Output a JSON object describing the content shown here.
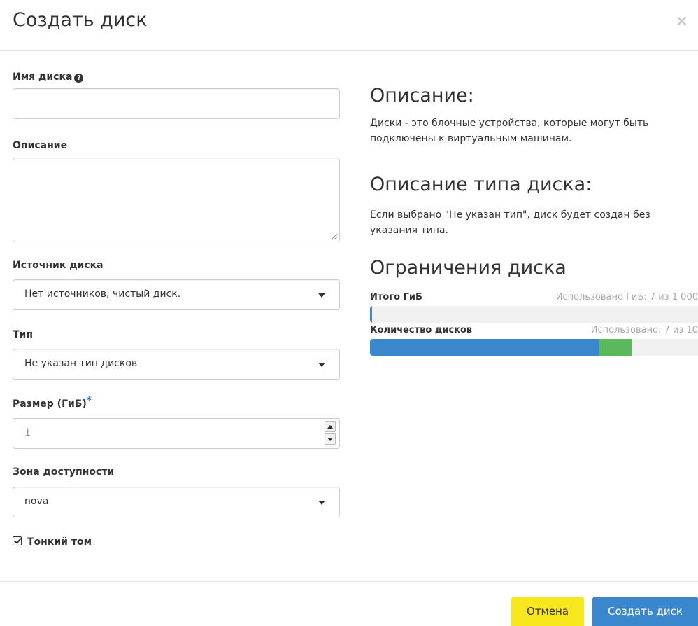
{
  "dialog": {
    "title": "Создать диск",
    "close": "×"
  },
  "form": {
    "name_label": "Имя диска",
    "name_help_icon": "question-circle-icon",
    "name_value": "",
    "description_label": "Описание",
    "description_value": "",
    "source_label": "Источник диска",
    "source_value": "Нет источников, чистый диск.",
    "type_label": "Тип",
    "type_value": "Не указан тип дисков",
    "size_label": "Размер (ГиБ)",
    "size_required_mark": "*",
    "size_value": "1",
    "zone_label": "Зона доступности",
    "zone_value": "nova",
    "thin_label": "Тонкий том",
    "thin_checked": true
  },
  "info": {
    "desc_heading": "Описание:",
    "desc_text": "Диски - это блочные устройства, которые могут быть подключены к виртуальным машинам.",
    "type_heading": "Описание типа диска:",
    "type_text": "Если выбрано \"Не указан тип\", диск будет создан без указания типа.",
    "limits_heading": "Ограничения диска"
  },
  "quotas": [
    {
      "label": "Итого ГиБ",
      "used_text": "Использовано ГиБ: 7 из 1 000",
      "used": 7,
      "new": 1,
      "max": 1000
    },
    {
      "label": "Количество дисков",
      "used_text": "Использовано: 7 из 10",
      "used": 7,
      "new": 1,
      "max": 10
    }
  ],
  "colors": {
    "primary": "#3b87cd",
    "cancel": "#f8e71c",
    "quota_new": "#5cb85c"
  },
  "footer": {
    "cancel_label": "Отмена",
    "submit_label": "Создать диск"
  }
}
